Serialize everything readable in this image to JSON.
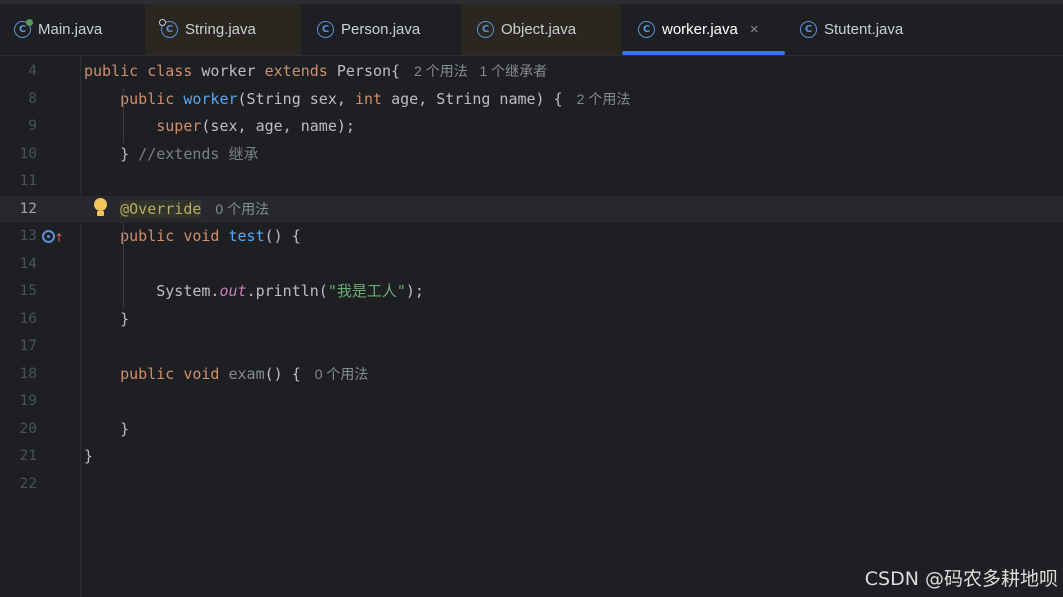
{
  "tabs": [
    {
      "label": "Main.java",
      "icon": "class-run-icon",
      "active": false
    },
    {
      "label": "String.java",
      "icon": "class-locked-icon",
      "active": false
    },
    {
      "label": "Person.java",
      "icon": "class-icon",
      "active": false
    },
    {
      "label": "Object.java",
      "icon": "class-icon",
      "active": false
    },
    {
      "label": "worker.java",
      "icon": "class-icon",
      "active": true,
      "close": "×"
    },
    {
      "label": "Stutent.java",
      "icon": "class-icon",
      "active": false
    }
  ],
  "class_icon_letter": "C",
  "editor": {
    "current_line": "12",
    "lines": [
      {
        "n": "4",
        "tokens": [
          [
            "kw",
            "public "
          ],
          [
            "kw",
            "class "
          ],
          [
            "",
            "worker "
          ],
          [
            "kw",
            "extends "
          ],
          [
            "",
            "Person{"
          ]
        ],
        "hint": "2 个用法   1 个继承者"
      },
      {
        "n": "8",
        "tokens": [
          [
            "",
            "    "
          ],
          [
            "kw",
            "public "
          ],
          [
            "fn",
            "worker"
          ],
          [
            "",
            "(String sex, "
          ],
          [
            "kw",
            "int "
          ],
          [
            "",
            "age, String name) {"
          ]
        ],
        "hint": "2 个用法"
      },
      {
        "n": "9",
        "tokens": [
          [
            "",
            "        "
          ],
          [
            "kw",
            "super"
          ],
          [
            "",
            "(sex, age, name);"
          ]
        ],
        "hint": ""
      },
      {
        "n": "10",
        "tokens": [
          [
            "",
            "    } "
          ],
          [
            "cm",
            "//extends 继承"
          ]
        ],
        "hint": ""
      },
      {
        "n": "11",
        "tokens": [],
        "hint": ""
      },
      {
        "n": "12",
        "tokens": [
          [
            "",
            "    "
          ],
          [
            "ann",
            "@Override"
          ]
        ],
        "hint": "0 个用法"
      },
      {
        "n": "13",
        "tokens": [
          [
            "",
            "    "
          ],
          [
            "kw",
            "public "
          ],
          [
            "kw",
            "void "
          ],
          [
            "fn",
            "test"
          ],
          [
            "",
            "() {"
          ]
        ],
        "hint": ""
      },
      {
        "n": "14",
        "tokens": [],
        "hint": ""
      },
      {
        "n": "15",
        "tokens": [
          [
            "",
            "        System."
          ],
          [
            "static",
            "out"
          ],
          [
            "",
            ".println("
          ],
          [
            "st",
            "\"我是工人\""
          ],
          [
            "",
            ");"
          ]
        ],
        "hint": ""
      },
      {
        "n": "16",
        "tokens": [
          [
            "",
            "    }"
          ]
        ],
        "hint": ""
      },
      {
        "n": "17",
        "tokens": [],
        "hint": ""
      },
      {
        "n": "18",
        "tokens": [
          [
            "",
            "    "
          ],
          [
            "kw",
            "public "
          ],
          [
            "kw",
            "void "
          ],
          [
            "fn-unused",
            "exam"
          ],
          [
            "",
            "() {"
          ]
        ],
        "hint": "0 个用法"
      },
      {
        "n": "19",
        "tokens": [],
        "hint": ""
      },
      {
        "n": "20",
        "tokens": [
          [
            "",
            "    }"
          ]
        ],
        "hint": ""
      },
      {
        "n": "21",
        "tokens": [
          [
            "",
            "}"
          ]
        ],
        "hint": ""
      },
      {
        "n": "22",
        "tokens": [],
        "hint": ""
      }
    ]
  },
  "gutter_icons": {
    "line12": "lightbulb-icon",
    "line13": "overriding-method-icon"
  },
  "watermark": "CSDN @码农多耕地呗",
  "colors": {
    "background": "#1e1f22",
    "keyword": "#cf8e6d",
    "function": "#56a8f5",
    "string": "#6aab73",
    "annotation": "#b3ae60",
    "active_tab_underline": "#3574f0"
  }
}
